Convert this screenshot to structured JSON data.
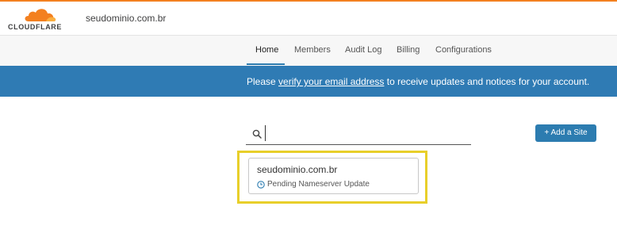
{
  "header": {
    "logo_text": "CLOUDFLARE",
    "account_name": "seudominio.com.br"
  },
  "nav": {
    "items": [
      {
        "label": "Home",
        "active": true
      },
      {
        "label": "Members",
        "active": false
      },
      {
        "label": "Audit Log",
        "active": false
      },
      {
        "label": "Billing",
        "active": false
      },
      {
        "label": "Configurations",
        "active": false
      }
    ]
  },
  "banner": {
    "prefix": "Please ",
    "link": "verify your email address",
    "suffix": " to receive updates and notices for your account."
  },
  "search": {
    "icon": "search-icon",
    "value": "",
    "placeholder": ""
  },
  "actions": {
    "add_site_label": "+ Add a Site"
  },
  "sites": [
    {
      "name": "seudominio.com.br",
      "status": "Pending Nameserver Update",
      "status_icon": "clock-icon"
    }
  ],
  "colors": {
    "accent_orange": "#f38020",
    "brand_blue": "#2f7bb4",
    "highlight_yellow": "#e8cf2a"
  }
}
